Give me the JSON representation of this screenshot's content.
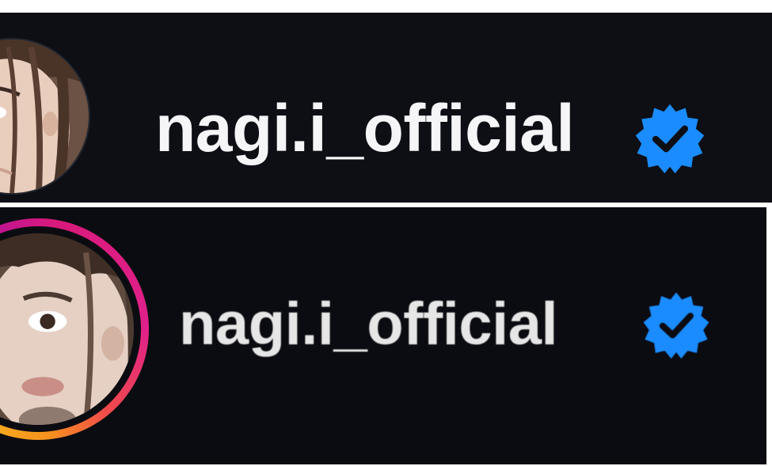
{
  "top_card": {
    "username": "nagi.i_official",
    "verified_icon": "verified-badge-icon",
    "avatar": "profile-photo",
    "colors": {
      "background": "#0d0f15",
      "username": "#f5f5f7",
      "badge": "#1a8cff"
    }
  },
  "bottom_card": {
    "username": "nagi.i_official",
    "verified_icon": "verified-badge-icon",
    "avatar": "profile-photo",
    "story_ring": true,
    "colors": {
      "background": "#0b0c11",
      "username": "#e6e6e6",
      "badge": "#1a8cff",
      "story_ring": [
        "#d91a7c",
        "#f7931e"
      ]
    }
  }
}
